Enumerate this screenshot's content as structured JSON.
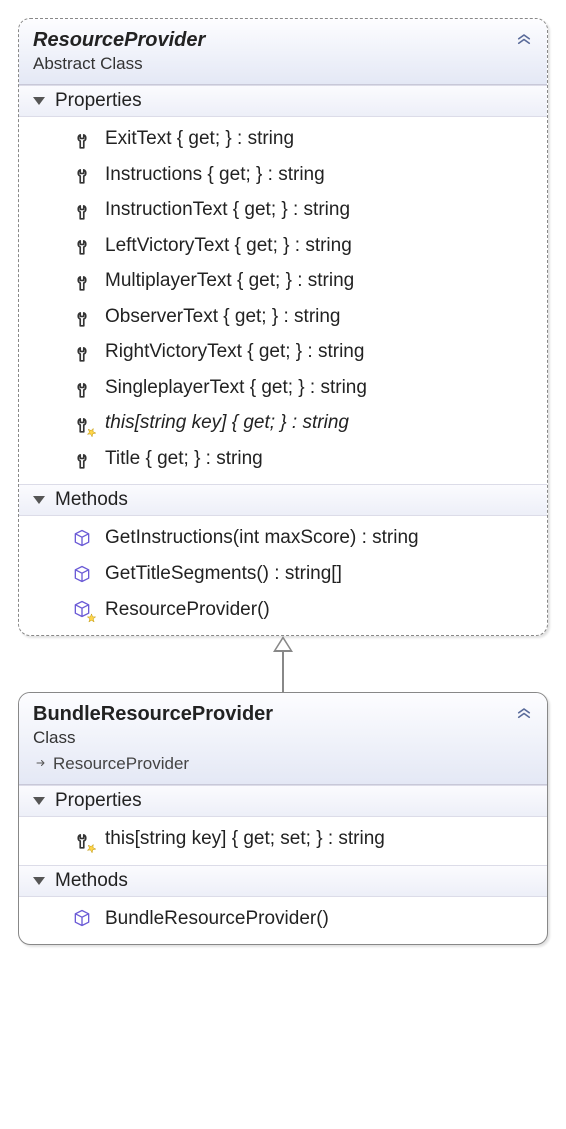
{
  "classes": [
    {
      "name": "ResourceProvider",
      "stereotype": "Abstract Class",
      "abstract": true,
      "inherits": null,
      "sections": [
        {
          "title": "Properties",
          "members": [
            {
              "icon": "wrench",
              "text": "ExitText { get; } : string",
              "italic": false
            },
            {
              "icon": "wrench",
              "text": "Instructions { get; } : string",
              "italic": false
            },
            {
              "icon": "wrench",
              "text": "InstructionText { get; } : string",
              "italic": false
            },
            {
              "icon": "wrench",
              "text": "LeftVictoryText { get; } : string",
              "italic": false
            },
            {
              "icon": "wrench",
              "text": "MultiplayerText { get; } : string",
              "italic": false
            },
            {
              "icon": "wrench",
              "text": "ObserverText { get; } : string",
              "italic": false
            },
            {
              "icon": "wrench",
              "text": "RightVictoryText { get; } : string",
              "italic": false
            },
            {
              "icon": "wrench",
              "text": "SingleplayerText { get; } : string",
              "italic": false
            },
            {
              "icon": "wrench-star",
              "text": "this[string key] { get; } : string",
              "italic": true
            },
            {
              "icon": "wrench",
              "text": "Title { get; } : string",
              "italic": false
            }
          ]
        },
        {
          "title": "Methods",
          "members": [
            {
              "icon": "cube",
              "text": "GetInstructions(int maxScore) : string",
              "italic": false
            },
            {
              "icon": "cube",
              "text": "GetTitleSegments() : string[]",
              "italic": false
            },
            {
              "icon": "cube-star",
              "text": "ResourceProvider()",
              "italic": false
            }
          ]
        }
      ]
    },
    {
      "name": "BundleResourceProvider",
      "stereotype": "Class",
      "abstract": false,
      "inherits": "ResourceProvider",
      "sections": [
        {
          "title": "Properties",
          "members": [
            {
              "icon": "wrench-star",
              "text": "this[string key] { get; set; } : string",
              "italic": false
            }
          ]
        },
        {
          "title": "Methods",
          "members": [
            {
              "icon": "cube",
              "text": "BundleResourceProvider()",
              "italic": false
            }
          ]
        }
      ]
    }
  ]
}
